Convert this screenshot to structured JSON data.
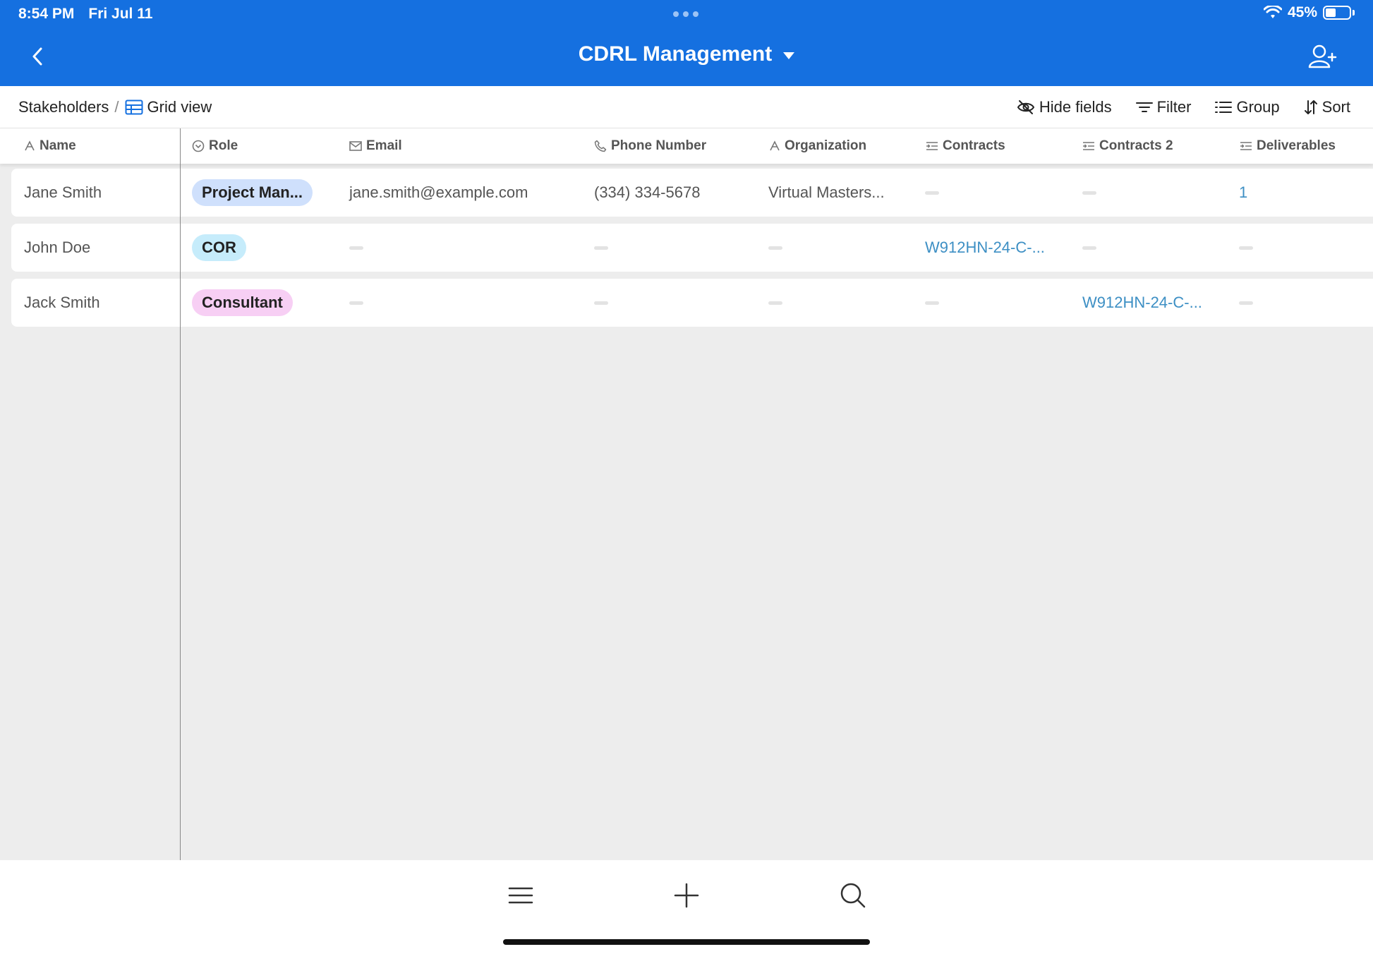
{
  "status": {
    "time": "8:54 PM",
    "date": "Fri Jul 11",
    "battery": "45%",
    "battery_level": 0.45
  },
  "header": {
    "title": "CDRL Management"
  },
  "toolbar": {
    "table_name": "Stakeholders",
    "separator": "/",
    "view_name": "Grid view",
    "hide_fields": "Hide fields",
    "filter": "Filter",
    "group": "Group",
    "sort": "Sort"
  },
  "columns": [
    "Name",
    "Role",
    "Email",
    "Phone Number",
    "Organization",
    "Contracts",
    "Contracts 2",
    "Deliverables"
  ],
  "rows": [
    {
      "name": "Jane Smith",
      "role": "Project Man...",
      "role_color": "#cfe0fc",
      "email": "jane.smith@example.com",
      "phone": "(334) 334-5678",
      "organization": "Virtual Masters...",
      "contracts": "",
      "contracts2": "",
      "deliverables": "1"
    },
    {
      "name": "John Doe",
      "role": "COR",
      "role_color": "#c6ecfb",
      "email": "",
      "phone": "",
      "organization": "",
      "contracts": "W912HN-24-C-...",
      "contracts2": "",
      "deliverables": ""
    },
    {
      "name": "Jack Smith",
      "role": "Consultant",
      "role_color": "#f7cff4",
      "email": "",
      "phone": "",
      "organization": "",
      "contracts": "",
      "contracts2": "W912HN-24-C-...",
      "deliverables": ""
    }
  ],
  "colors": {
    "header_bg": "#1570e0",
    "link": "#3d8fc4",
    "grid_bg": "#ededed"
  }
}
